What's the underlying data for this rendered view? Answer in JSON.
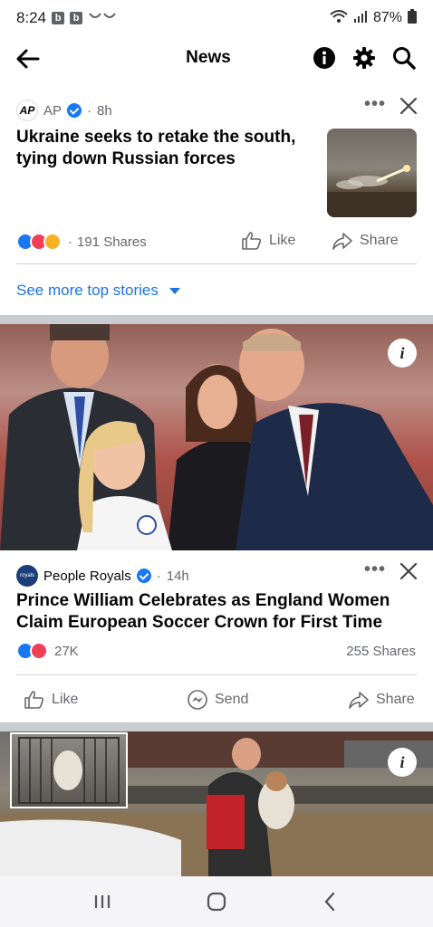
{
  "status_bar": {
    "time": "8:24",
    "notif_badges": [
      "b",
      "b"
    ],
    "battery": "87%"
  },
  "app_bar": {
    "title": "News"
  },
  "story1": {
    "source": "AP",
    "age": "8h",
    "headline": "Ukraine seeks to retake the south, tying down Russian forces",
    "shares": "191 Shares",
    "like_label": "Like",
    "share_label": "Share"
  },
  "see_more": {
    "label": "See more top stories"
  },
  "story2": {
    "source": "People Royals",
    "age": "14h",
    "headline": "Prince William Celebrates as England Women Claim European Soccer Crown for First Time",
    "reaction_count": "27K",
    "shares": "255 Shares",
    "like_label": "Like",
    "send_label": "Send",
    "share_label": "Share"
  },
  "photo_info_label": "i",
  "colors": {
    "accent": "#1b74e4",
    "like_blue": "#1877f2",
    "love_red": "#f33e58",
    "care_yellow": "#f7b125",
    "secondary_text": "#65676b",
    "divider": "#c9ccd1"
  }
}
